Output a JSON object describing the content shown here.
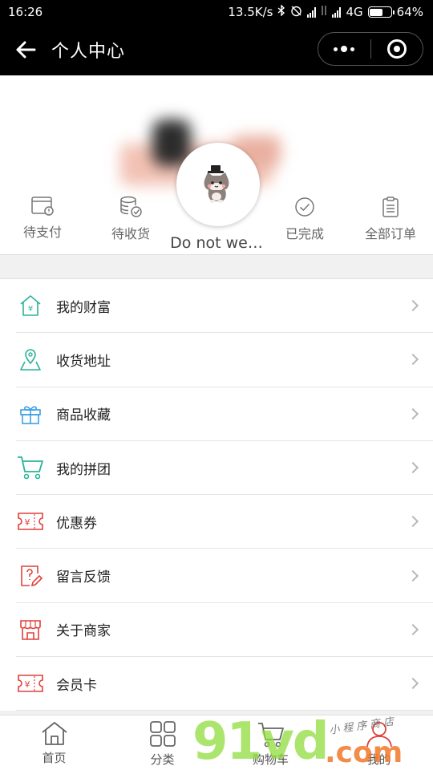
{
  "status_bar": {
    "time": "16:26",
    "speed": "13.5K/s",
    "network": "4G",
    "battery": "64%",
    "battery_level": 0.64
  },
  "header": {
    "title": "个人中心"
  },
  "profile": {
    "nickname": "Do not we…",
    "orders": [
      {
        "label": "待支付",
        "icon": "wallet-icon"
      },
      {
        "label": "待收货",
        "icon": "coin-stack-icon"
      },
      {
        "label": "已完成",
        "icon": "check-circle-icon"
      },
      {
        "label": "全部订单",
        "icon": "clipboard-icon"
      }
    ]
  },
  "menu": {
    "items": [
      {
        "label": "我的财富",
        "icon": "wealth-house-icon"
      },
      {
        "label": "收货地址",
        "icon": "map-pin-icon"
      },
      {
        "label": "商品收藏",
        "icon": "gift-icon"
      },
      {
        "label": "我的拼团",
        "icon": "cart-icon"
      },
      {
        "label": "优惠券",
        "icon": "coupon-icon"
      },
      {
        "label": "留言反馈",
        "icon": "feedback-icon"
      },
      {
        "label": "关于商家",
        "icon": "store-icon"
      },
      {
        "label": "会员卡",
        "icon": "member-card-icon"
      }
    ]
  },
  "tabs": [
    {
      "label": "首页",
      "icon": "home-icon"
    },
    {
      "label": "分类",
      "icon": "grid-icon"
    },
    {
      "label": "购物车",
      "icon": "cart-icon"
    },
    {
      "label": "我的",
      "icon": "user-icon"
    }
  ],
  "watermark": {
    "number": "91vd",
    "domain": ".com",
    "tagline": "小程序商店"
  },
  "colors": {
    "teal": "#2bb39b",
    "blue": "#3ba0e6",
    "red": "#e0403c",
    "black": "#000000"
  }
}
